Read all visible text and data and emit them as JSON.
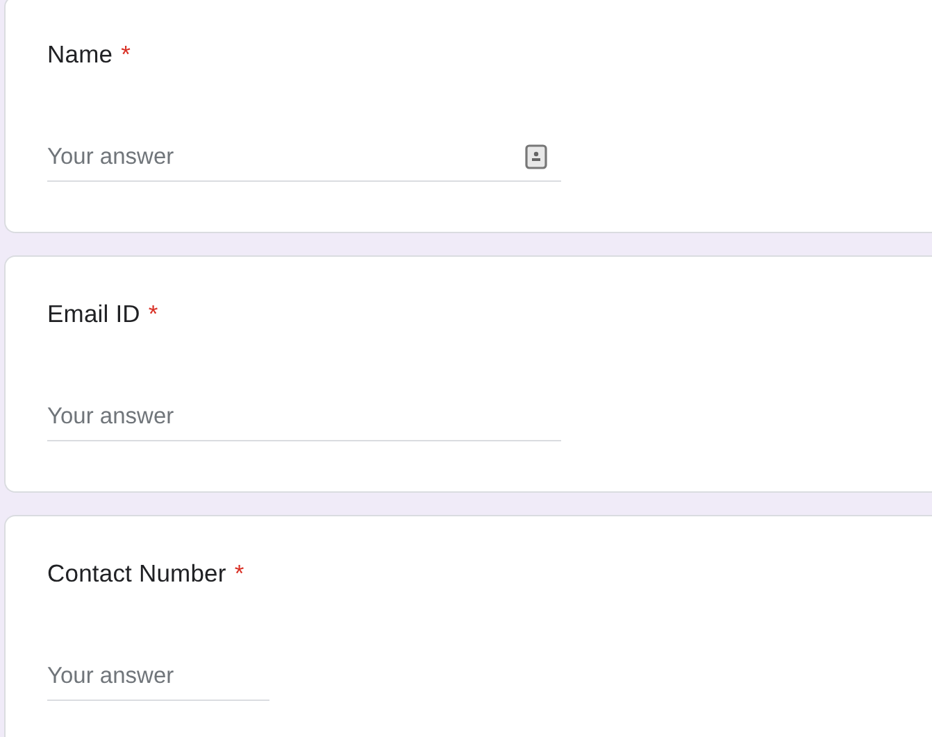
{
  "questions": [
    {
      "label": "Name",
      "required_mark": "*",
      "kind": "name",
      "placeholder": "Your answer"
    },
    {
      "label": "Email ID",
      "required_mark": "*",
      "kind": "email",
      "placeholder": "Your answer"
    },
    {
      "label": "Contact Number",
      "required_mark": "*",
      "kind": "phone",
      "placeholder": "Your answer"
    }
  ]
}
